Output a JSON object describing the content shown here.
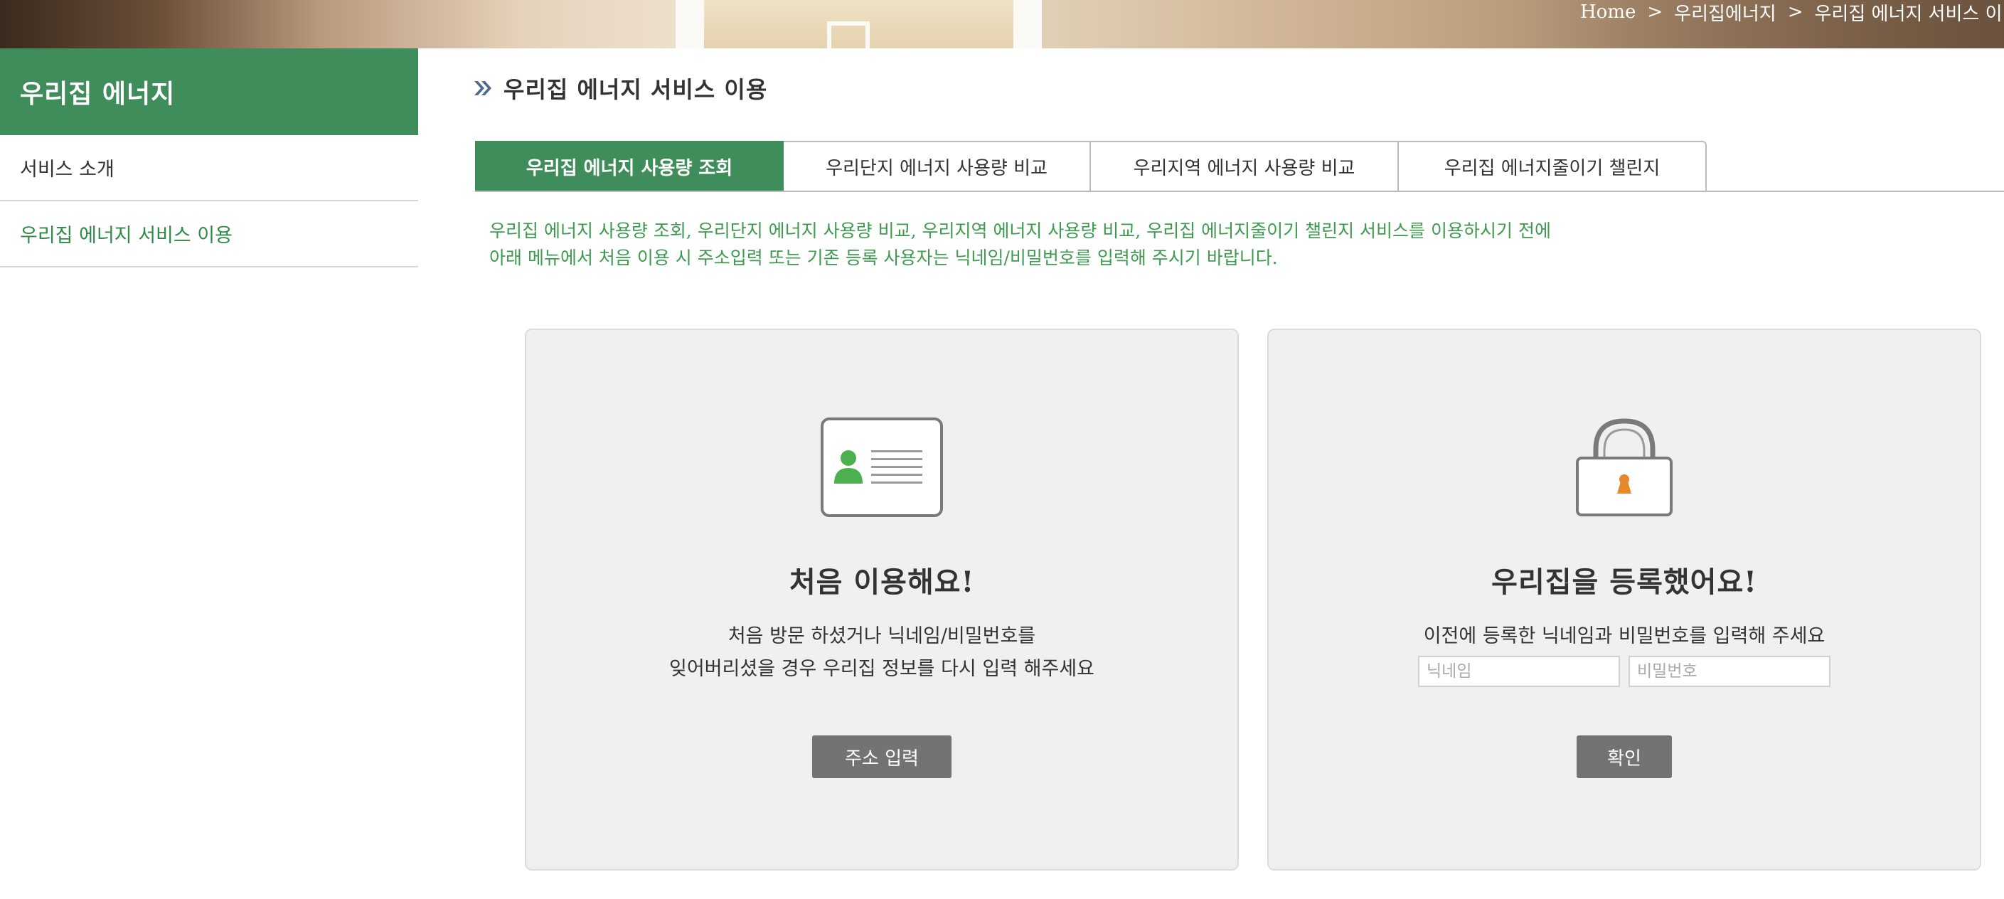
{
  "banner": {
    "breadcrumb": [
      "Home",
      "우리집에너지",
      "우리집 에너지 서비스 이"
    ],
    "separator": ">"
  },
  "sidebar": {
    "title": "우리집 에너지",
    "items": [
      {
        "label": "서비스 소개",
        "active": false
      },
      {
        "label": "우리집 에너지 서비스 이용",
        "active": true
      }
    ]
  },
  "main": {
    "title": "우리집 에너지 서비스 이용",
    "tabs": [
      {
        "label": "우리집 에너지 사용량 조회",
        "active": true
      },
      {
        "label": "우리단지 에너지 사용량 비교",
        "active": false
      },
      {
        "label": "우리지역 에너지 사용량 비교",
        "active": false
      },
      {
        "label": "우리집 에너지줄이기 챌린지",
        "active": false
      }
    ],
    "notice_lines": [
      "우리집 에너지 사용량 조회, 우리단지 에너지 사용량 비교, 우리지역 에너지 사용량 비교, 우리집 에너지줄이기 챌린지 서비스를 이용하시기 전에",
      "아래 메뉴에서 처음 이용 시 주소입력 또는 기존 등록 사용자는 닉네임/비밀번호를 입력해 주시기 바랍니다."
    ]
  },
  "cards": {
    "first_time": {
      "icon": "id-card-icon",
      "heading": "처음 이용해요!",
      "desc_lines": [
        "처음 방문 하셨거나 닉네임/비밀번호를",
        "잊어버리셨을 경우 우리집 정보를 다시 입력 해주세요"
      ],
      "button_label": "주소 입력"
    },
    "registered": {
      "icon": "lock-icon",
      "heading": "우리집을 등록했어요!",
      "desc": "이전에 등록한 닉네임과 비밀번호를 입력해 주세요",
      "nickname_placeholder": "닉네임",
      "password_placeholder": "비밀번호",
      "button_label": "확인"
    }
  },
  "colors": {
    "brand_green": "#3f8d5a",
    "notice_green": "#3e9a4e",
    "lock_keyhole": "#e8862a",
    "button_gray": "#737373"
  }
}
